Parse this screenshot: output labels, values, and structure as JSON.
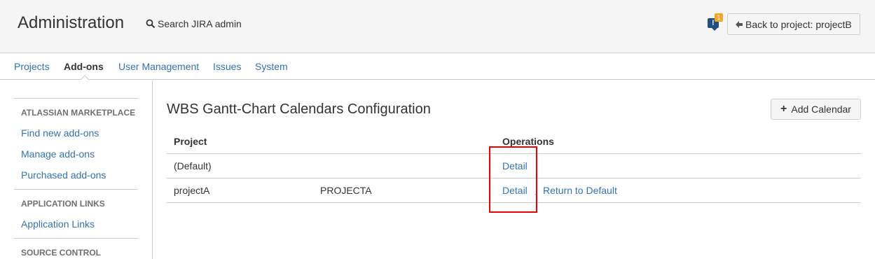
{
  "header": {
    "title": "Administration",
    "search_label": "Search JIRA admin",
    "notification_count": "1",
    "back_label": "Back to project: projectB"
  },
  "nav": {
    "items": [
      "Projects",
      "Add-ons",
      "User Management",
      "Issues",
      "System"
    ],
    "active": "Add-ons"
  },
  "sidebar": {
    "sections": [
      {
        "heading": "ATLASSIAN MARKETPLACE",
        "links": [
          "Find new add-ons",
          "Manage add-ons",
          "Purchased add-ons"
        ]
      },
      {
        "heading": "APPLICATION LINKS",
        "links": [
          "Application Links"
        ]
      },
      {
        "heading": "SOURCE CONTROL",
        "links": []
      }
    ]
  },
  "main": {
    "title": "WBS Gantt-Chart Calendars Configuration",
    "add_button_label": "Add Calendar",
    "columns": [
      "Project",
      "Operations"
    ],
    "rows": [
      {
        "project": "(Default)",
        "key": "",
        "operations": [
          "Detail"
        ]
      },
      {
        "project": "projectA",
        "key": "PROJECTA",
        "operations": [
          "Detail",
          "Return to Default"
        ]
      }
    ],
    "separator": "·"
  },
  "colors": {
    "link": "#3572b0",
    "highlight": "#e00000",
    "notification_badge": "#f6a623"
  }
}
